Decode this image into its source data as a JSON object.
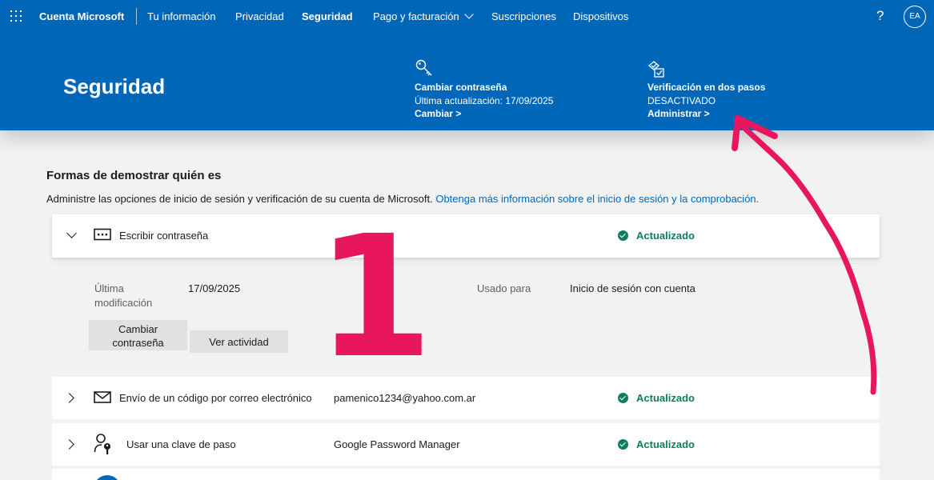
{
  "topnav": {
    "brand": "Cuenta Microsoft",
    "links": [
      "Tu información",
      "Privacidad",
      "Seguridad",
      "Pago y facturación",
      "Suscripciones",
      "Dispositivos"
    ],
    "help": "?",
    "avatar_initials": "EA"
  },
  "banner": {
    "title": "Seguridad",
    "password": {
      "title": "Cambiar contraseña",
      "subtitle": "Última actualización: 17/09/2025",
      "link": "Cambiar >"
    },
    "twostep": {
      "title": "Verificación en dos pasos",
      "subtitle": "DESACTIVADO",
      "link": "Administrar >"
    }
  },
  "section": {
    "title": "Formas de demostrar quién es",
    "description": "Administre las opciones de inicio de sesión y verificación de su cuenta de Microsoft.",
    "link": "Obtenga más información sobre el inicio de sesión y la comprobación."
  },
  "methods": [
    {
      "label": "Escribir contraseña",
      "value": "",
      "status": "Actualizado",
      "icon": "password-dots-icon"
    },
    {
      "label": "Envío de un código por correo electrónico",
      "value": "pamenico1234@yahoo.com.ar",
      "status": "Actualizado",
      "icon": "mail-icon"
    },
    {
      "label": "Usar una clave de paso",
      "value": "Google Password Manager",
      "status": "Actualizado",
      "icon": "person-key-icon"
    }
  ],
  "details": {
    "modified_label": "Última modificación",
    "modified_value": "17/09/2025",
    "used_label": "Usado para",
    "used_value": "Inicio de sesión con cuenta",
    "change_button": "Cambiar contraseña",
    "activity_button": "Ver actividad"
  },
  "annotation": {
    "number": "1",
    "color": "#e8175d"
  },
  "colors": {
    "brand_blue": "#0067b8",
    "status_green": "#107c5f"
  }
}
